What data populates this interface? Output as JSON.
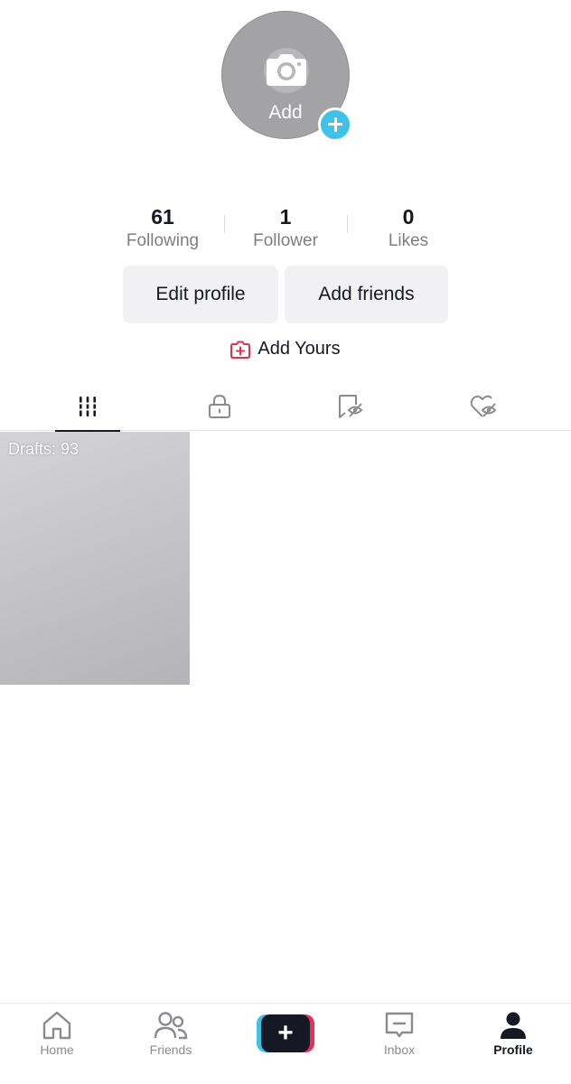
{
  "profile": {
    "avatar_add_label": "Add"
  },
  "stats": [
    {
      "value": "61",
      "label": "Following"
    },
    {
      "value": "1",
      "label": "Follower"
    },
    {
      "value": "0",
      "label": "Likes"
    }
  ],
  "actions": {
    "edit_profile_label": "Edit profile",
    "add_friends_label": "Add friends",
    "add_yours_label": "Add Yours"
  },
  "tabs": [
    {
      "icon": "grid-icon",
      "active": true
    },
    {
      "icon": "lock-icon",
      "active": false
    },
    {
      "icon": "hidden-bookmark-icon",
      "active": false
    },
    {
      "icon": "hidden-heart-icon",
      "active": false
    }
  ],
  "content": {
    "drafts_label": "Drafts: 93"
  },
  "bottom_nav": {
    "items": [
      {
        "label": "Home",
        "icon": "home-icon"
      },
      {
        "label": "Friends",
        "icon": "friends-icon"
      },
      {
        "label": "",
        "icon": "create-plus-icon"
      },
      {
        "label": "Inbox",
        "icon": "inbox-icon"
      },
      {
        "label": "Profile",
        "icon": "profile-icon"
      }
    ],
    "active": "Profile"
  },
  "colors": {
    "text": "#161823",
    "muted": "#7d7e85",
    "button_bg": "#f1f1f3",
    "accent_cyan": "#3ec3e6",
    "accent_red": "#ee2d56"
  }
}
